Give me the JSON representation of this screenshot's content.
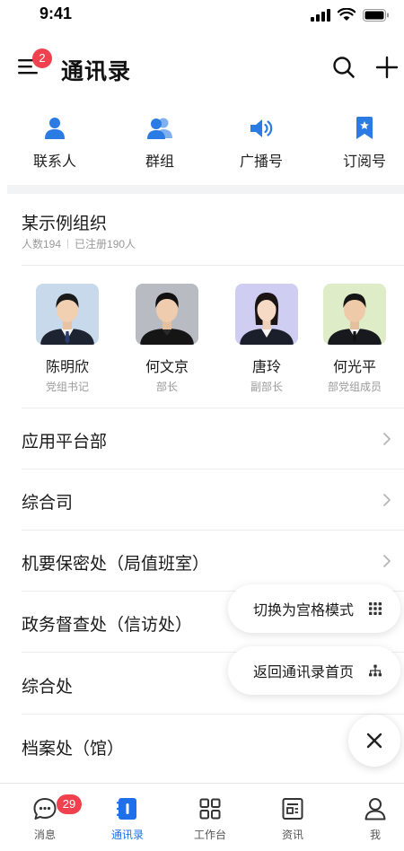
{
  "status_bar": {
    "time": "9:41"
  },
  "header": {
    "title": "通讯录",
    "menu_badge": "2"
  },
  "quick_links": [
    {
      "label": "联系人",
      "icon": "person-icon"
    },
    {
      "label": "群组",
      "icon": "group-icon"
    },
    {
      "label": "广播号",
      "icon": "speaker-icon"
    },
    {
      "label": "订阅号",
      "icon": "bookmark-icon"
    }
  ],
  "organization": {
    "name": "某示例组织",
    "member_count": "人数194",
    "registered": "已注册190人"
  },
  "leaders": [
    {
      "name": "陈明欣",
      "role": "党组书记",
      "photo_bg": "#c9d9ec"
    },
    {
      "name": "何文京",
      "role": "部长",
      "photo_bg": "#b8bcc2"
    },
    {
      "name": "唐玲",
      "role": "副部长",
      "photo_bg": "#cfcdf2"
    },
    {
      "name": "何光平",
      "role": "部党组成员",
      "photo_bg": "#dfecc8"
    }
  ],
  "departments": [
    {
      "name": "应用平台部"
    },
    {
      "name": "综合司"
    },
    {
      "name": "机要保密处（局值班室）"
    },
    {
      "name": "政务督查处（信访处）"
    },
    {
      "name": "综合处"
    },
    {
      "name": "档案处（馆）"
    }
  ],
  "floating_actions": {
    "grid_mode": "切换为宫格模式",
    "back_home": "返回通讯录首页"
  },
  "tabbar": [
    {
      "label": "消息",
      "icon": "message-icon",
      "badge": "29"
    },
    {
      "label": "通讯录",
      "icon": "contacts-book-icon",
      "active": true
    },
    {
      "label": "工作台",
      "icon": "grid-icon"
    },
    {
      "label": "资讯",
      "icon": "news-icon"
    },
    {
      "label": "我",
      "icon": "profile-icon"
    }
  ],
  "colors": {
    "accent": "#1f6feb",
    "badge": "#f0414e",
    "muted": "#9a9a9a"
  }
}
